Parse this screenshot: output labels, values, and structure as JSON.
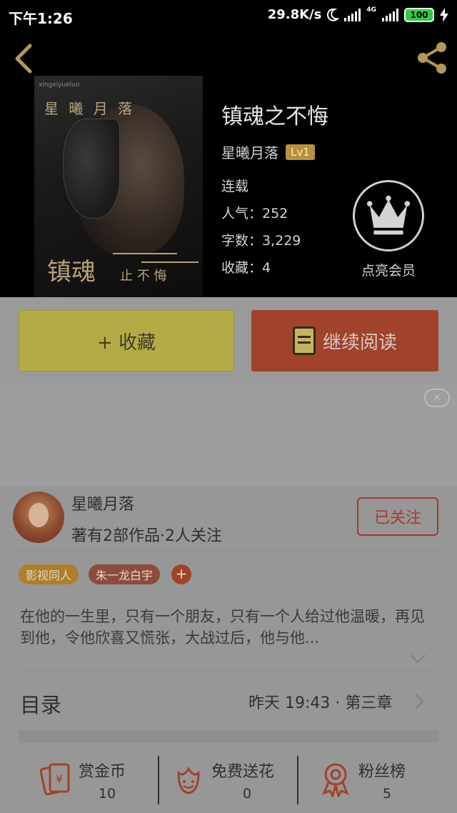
{
  "status_bar": {
    "time": "下午1:26",
    "speed": "29.8K/s",
    "network": "4G",
    "battery": "100"
  },
  "book": {
    "title": "镇魂之不悔",
    "author": "星曦月落",
    "author_level": "Lv1",
    "status": "连载",
    "popularity": "人气：252",
    "word_count": "字数：3,229",
    "favorites": "收藏：4"
  },
  "cover": {
    "title": "星 曦 月 落",
    "subtitle": "xingxiyueluo",
    "calligraphy": "镇魂",
    "small": "止 不 悔"
  },
  "vip": {
    "label": "点亮会员",
    "icon": "crown-icon"
  },
  "actions": {
    "collect_label": "+ 收藏",
    "read_label": "继续阅读"
  },
  "ad": {
    "close": "×"
  },
  "author_card": {
    "name": "星曦月落",
    "stats": "著有2部作品·2人关注",
    "follow_label": "已关注"
  },
  "tags": [
    "影视同人",
    "朱一龙白宇"
  ],
  "tag_add": "+",
  "intro": "在他的一生里，只有一个朋友，只有一个人给过他温暖，再见到他，令他欣喜又慌张，大战过后，他与他...",
  "toc": {
    "label": "目录",
    "latest": "昨天 19:43 · 第三章"
  },
  "bottom": [
    {
      "label": "赏金币",
      "value": "10",
      "icon": "red-envelope-icon"
    },
    {
      "label": "免费送花",
      "value": "0",
      "icon": "flower-icon"
    },
    {
      "label": "粉丝榜",
      "value": "5",
      "icon": "medal-icon"
    }
  ],
  "colors": {
    "accent_red": "#a0432a",
    "collect_yellow": "#b3ab45",
    "level_gold": "#b8913d"
  }
}
